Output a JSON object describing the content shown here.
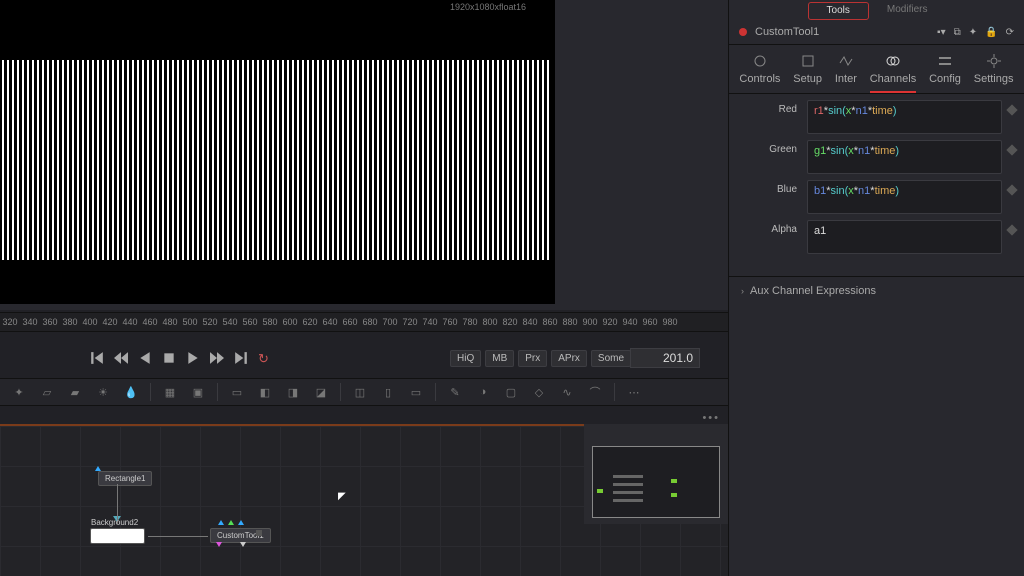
{
  "viewer": {
    "info": "1920x1080xfloat16"
  },
  "ruler": [
    "320",
    "340",
    "360",
    "380",
    "400",
    "420",
    "440",
    "460",
    "480",
    "500",
    "520",
    "540",
    "560",
    "580",
    "600",
    "620",
    "640",
    "660",
    "680",
    "700",
    "720",
    "740",
    "760",
    "780",
    "800",
    "820",
    "840",
    "860",
    "880",
    "900",
    "920",
    "940",
    "960",
    "980"
  ],
  "playback": {
    "tags": [
      "HiQ",
      "MB",
      "Prx",
      "APrx",
      "Some"
    ],
    "frame": "201.0"
  },
  "nodes": {
    "rectangle": "Rectangle1",
    "background": "Background2",
    "customtool": "CustomTool1"
  },
  "panel_top_tabs": {
    "a": "Tools",
    "b": "Modifiers"
  },
  "header": {
    "title": "CustomTool1"
  },
  "inspector_tabs": [
    "Controls",
    "Setup",
    "Inter",
    "Channels",
    "Config",
    "Settings"
  ],
  "expressions": {
    "red": {
      "label": "Red",
      "r": "r1",
      "op": "*",
      "fn": "sin(",
      "x": "x",
      "n": "n1",
      "t": "time",
      "close": ")"
    },
    "green": {
      "label": "Green",
      "r": "g1",
      "op": "*",
      "fn": "sin(",
      "x": "x",
      "n": "n1",
      "t": "time",
      "close": ")"
    },
    "blue": {
      "label": "Blue",
      "r": "b1",
      "op": "*",
      "fn": "sin(",
      "x": "x",
      "n": "n1",
      "t": "time",
      "close": ")"
    },
    "alpha": {
      "label": "Alpha",
      "val": "a1"
    }
  },
  "aux_section": "Aux Channel Expressions"
}
